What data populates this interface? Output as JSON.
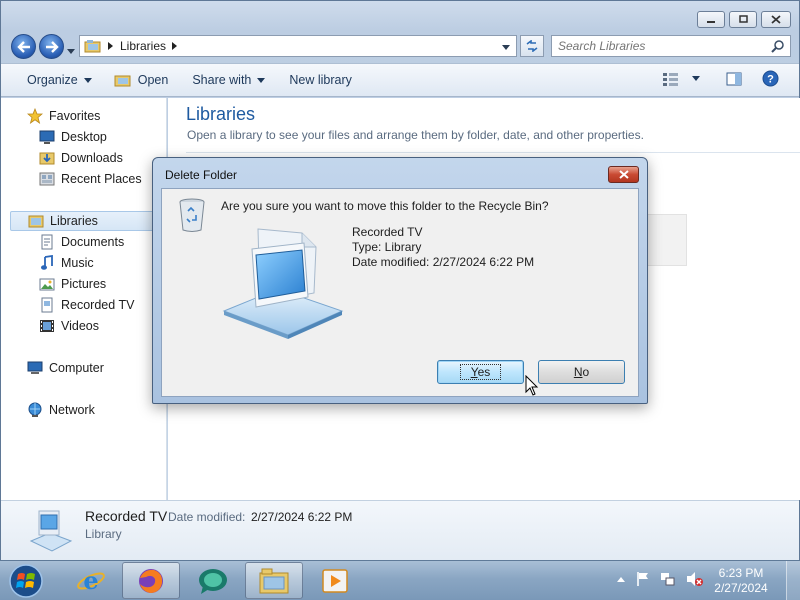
{
  "explorer": {
    "address": {
      "crumb": "Libraries"
    },
    "search": {
      "placeholder": "Search Libraries"
    },
    "toolbar": {
      "organize": "Organize",
      "open": "Open",
      "share_with": "Share with",
      "new_library": "New library"
    },
    "nav": {
      "favorites": "Favorites",
      "desktop": "Desktop",
      "downloads": "Downloads",
      "recent_places": "Recent Places",
      "libraries": "Libraries",
      "documents": "Documents",
      "music": "Music",
      "pictures": "Pictures",
      "recorded_tv": "Recorded TV",
      "videos": "Videos",
      "computer": "Computer",
      "network": "Network"
    },
    "content": {
      "title": "Libraries",
      "subtitle": "Open a library to see your files and arrange them by folder, date, and other properties."
    },
    "details": {
      "name": "Recorded TV",
      "modified_label": "Date modified:",
      "modified_value": "2/27/2024 6:22 PM",
      "type": "Library"
    }
  },
  "dialog": {
    "title": "Delete Folder",
    "question": "Are you sure you want to move this folder to the Recycle Bin?",
    "folder_name": "Recorded TV",
    "folder_type": "Type: Library",
    "folder_date": "Date modified: 2/27/2024 6:22 PM",
    "yes_label": "es",
    "yes_mnemonic": "Y",
    "no_label": "o",
    "no_mnemonic": "N"
  },
  "taskbar": {
    "time": "6:23 PM",
    "date": "2/27/2024"
  },
  "colors": {
    "accent": "#1e5aa0",
    "title_bar": "#c3d6ec",
    "taskbar": "#8aa6c3"
  }
}
